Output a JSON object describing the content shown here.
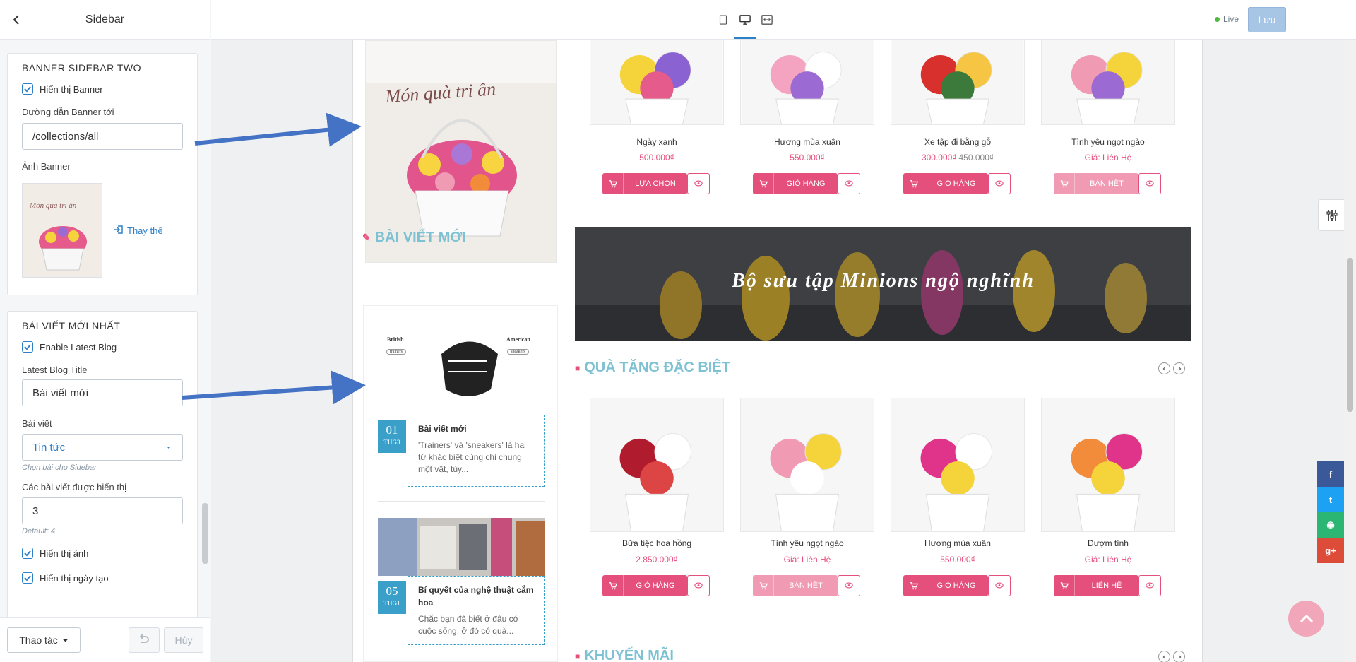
{
  "sidebar": {
    "title": "Sidebar",
    "banner2": {
      "heading": "BANNER SIDEBAR TWO",
      "show_label": "Hiển thị Banner",
      "link_label": "Đường dẫn Banner tới",
      "link_value": "/collections/all",
      "image_label": "Ảnh Banner",
      "replace_label": "Thay thế",
      "thumb_text": "Món quà tri ân"
    },
    "latest": {
      "heading": "BÀI VIẾT MỚI NHẤT",
      "enable_label": "Enable Latest Blog",
      "title_label": "Latest Blog Title",
      "title_value": "Bài viết mới",
      "blog_label": "Bài viết",
      "blog_value": "Tin tức",
      "blog_hint": "Chọn bài cho Sidebar",
      "count_label": "Các bài viết được hiển thị",
      "count_value": "3",
      "count_hint": "Default: 4",
      "show_image_label": "Hiển thị ảnh",
      "show_date_label": "Hiển thị ngày tạo"
    },
    "footer": {
      "actions_label": "Thao tác",
      "cancel_label": "Hủy"
    }
  },
  "topbar": {
    "live_label": "Live",
    "save_label": "Lưu"
  },
  "preview": {
    "banner_text": "Món quà tri ân",
    "blog_section_title": "BÀI VIẾT MỚI",
    "posts": [
      {
        "day": "01",
        "month": "THG3",
        "title": "Bài viết mới",
        "excerpt": "'Trainers' và 'sneakers' là hai từ khác biệt cùng chỉ chung một vật, tùy...",
        "img_left": "British",
        "img_left_tag": "trainers",
        "img_right": "American",
        "img_right_tag": "sneakers"
      },
      {
        "day": "05",
        "month": "THG1",
        "title": "Bí quyết của nghệ thuật cắm hoa",
        "excerpt": "Chắc bạn đã biết ở đâu có cuộc sống, ở đó có quà..."
      }
    ],
    "row1": [
      {
        "name": "Ngày xanh",
        "price": "500.000₫",
        "old": "",
        "btn": "LỰA CHỌN",
        "dis": false
      },
      {
        "name": "Hương mùa xuân",
        "price": "550.000₫",
        "old": "",
        "btn": "GIỎ HÀNG",
        "dis": false
      },
      {
        "name": "Xe tập đi bằng gỗ",
        "price": "300.000₫",
        "old": "450.000₫",
        "btn": "GIỎ HÀNG",
        "dis": false
      },
      {
        "name": "Tình yêu ngọt ngào",
        "price": "Giá: Liên Hệ",
        "old": "",
        "btn": "BÁN HẾT",
        "dis": true
      }
    ],
    "promo_banner": "Bộ sưu tập Minions ngộ nghĩnh",
    "special_title": "QUÀ TẶNG ĐẶC BIỆT",
    "row2": [
      {
        "name": "Bữa tiệc hoa hồng",
        "price": "2.850.000₫",
        "btn": "GIỎ HÀNG",
        "dis": false
      },
      {
        "name": "Tình yêu ngọt ngào",
        "price": "Giá: Liên Hệ",
        "btn": "BÁN HẾT",
        "dis": true
      },
      {
        "name": "Hương mùa xuân",
        "price": "550.000₫",
        "btn": "GIỎ HÀNG",
        "dis": false
      },
      {
        "name": "Đượm tình",
        "price": "Giá: Liên Hệ",
        "btn": "LIÊN HỆ",
        "dis": false
      }
    ],
    "promo_title": "KHUYẾN MÃI"
  },
  "colors": {
    "accent": "#2f80c7",
    "pink": "#e44f7c",
    "teal": "#7dc1d3",
    "arrow": "#4472c4"
  }
}
